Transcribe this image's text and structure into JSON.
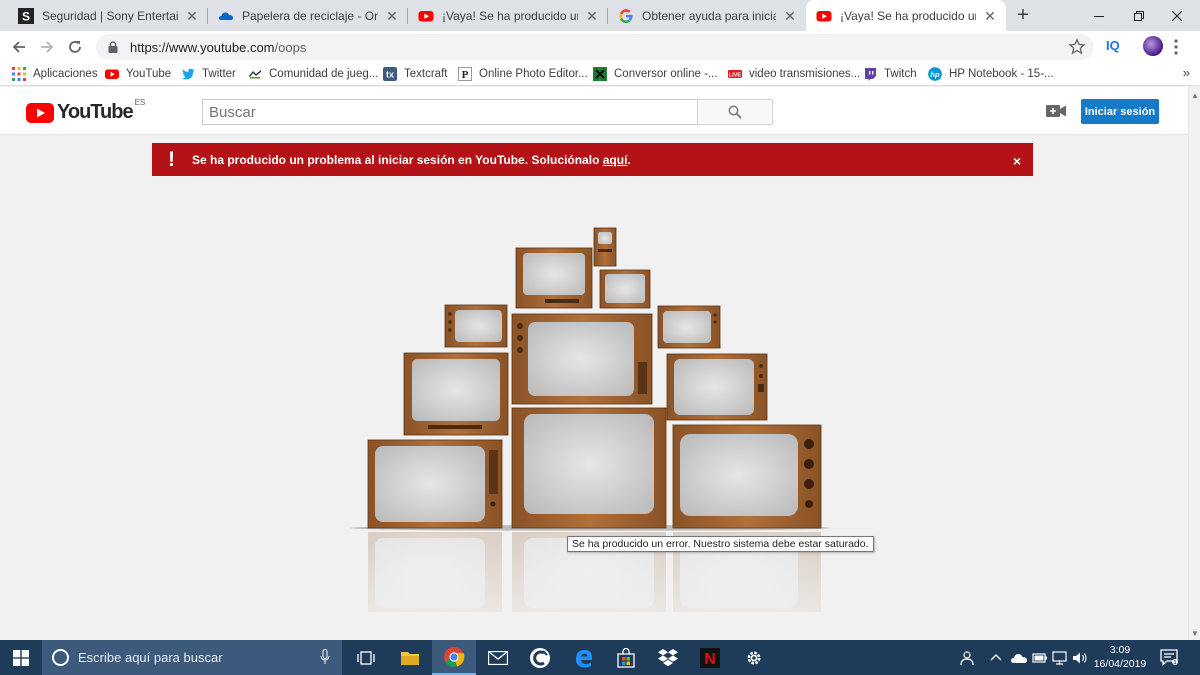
{
  "browser": {
    "tabs": [
      {
        "title": "Seguridad | Sony Entertainmen",
        "favicon": "sony-s-icon",
        "active": false
      },
      {
        "title": "Papelera de reciclaje - OneDriv",
        "favicon": "onedrive-icon",
        "active": false
      },
      {
        "title": "¡Vaya! Se ha producido un erro",
        "favicon": "youtube-icon",
        "active": false
      },
      {
        "title": "Obtener ayuda para iniciar sesi",
        "favicon": "google-icon",
        "active": false
      },
      {
        "title": "¡Vaya! Se ha producido un erro",
        "favicon": "youtube-icon",
        "active": true
      }
    ],
    "new_tab": "+",
    "close_glyph": "✕",
    "url_host": "https://www.youtube.com",
    "url_path": "/oops",
    "extension_label": "IQ",
    "more_bookmarks": "»",
    "bookmarks": [
      {
        "label": "Aplicaciones",
        "icon": "apps-grid-icon"
      },
      {
        "label": "YouTube",
        "icon": "youtube-icon"
      },
      {
        "label": "Twitter",
        "icon": "twitter-icon"
      },
      {
        "label": "Comunidad de jueg...",
        "icon": "game-community-icon"
      },
      {
        "label": "Textcraft",
        "icon": "textcraft-icon"
      },
      {
        "label": "Online Photo Editor...",
        "icon": "photo-editor-icon"
      },
      {
        "label": "Conversor online -...",
        "icon": "converter-icon"
      },
      {
        "label": "video transmisiones...",
        "icon": "live-icon"
      },
      {
        "label": "Twitch",
        "icon": "twitch-icon"
      },
      {
        "label": "HP Notebook - 15-...",
        "icon": "hp-icon"
      }
    ],
    "live_badge": "LIVE"
  },
  "youtube": {
    "logo_text": "YouTube",
    "region": "ES",
    "search_placeholder": "Buscar",
    "signin_label": "Iniciar sesión",
    "alert": {
      "bang": "!",
      "message": "Se ha producido un problema al iniciar sesión en YouTube. Soluciónalo ",
      "link": "aquí",
      "suffix": ".",
      "close": "×"
    },
    "tooltip": "Se ha producido un error. Nuestro sistema debe estar saturado."
  },
  "taskbar": {
    "search_placeholder": "Escribe aquí para buscar",
    "time": "3:09",
    "date": "16/04/2019",
    "netflix_letter": "N"
  },
  "colors": {
    "youtube_red": "#ff0000",
    "alert_red": "#b31217",
    "signin_blue": "#167ac6",
    "tv_wood": "#a0632e"
  }
}
